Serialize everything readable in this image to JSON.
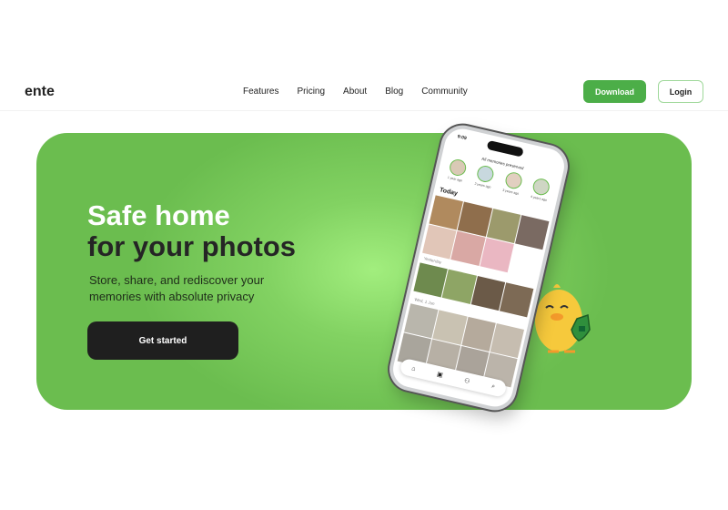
{
  "nav": {
    "logo": "ente",
    "links": [
      "Features",
      "Pricing",
      "About",
      "Blog",
      "Community"
    ],
    "download": "Download",
    "login": "Login"
  },
  "hero": {
    "title_line1": "Safe home",
    "title_line2": "for your photos",
    "subtitle": "Store, share, and rediscover your memories with absolute privacy",
    "cta": "Get started"
  },
  "phone": {
    "time": "9:09",
    "memories_title": "All memories preserved",
    "memories": [
      "1 year ago",
      "2 years ago",
      "3 years ago",
      "4 years ago"
    ],
    "sections": [
      "Today",
      "Yesterday",
      "Wed, 1 Jun"
    ],
    "tabs": [
      "home-icon",
      "gallery-icon",
      "people-icon",
      "search-icon"
    ]
  },
  "colors": {
    "brand": "#4cae48",
    "hero_bg": "#6bbd4f"
  }
}
